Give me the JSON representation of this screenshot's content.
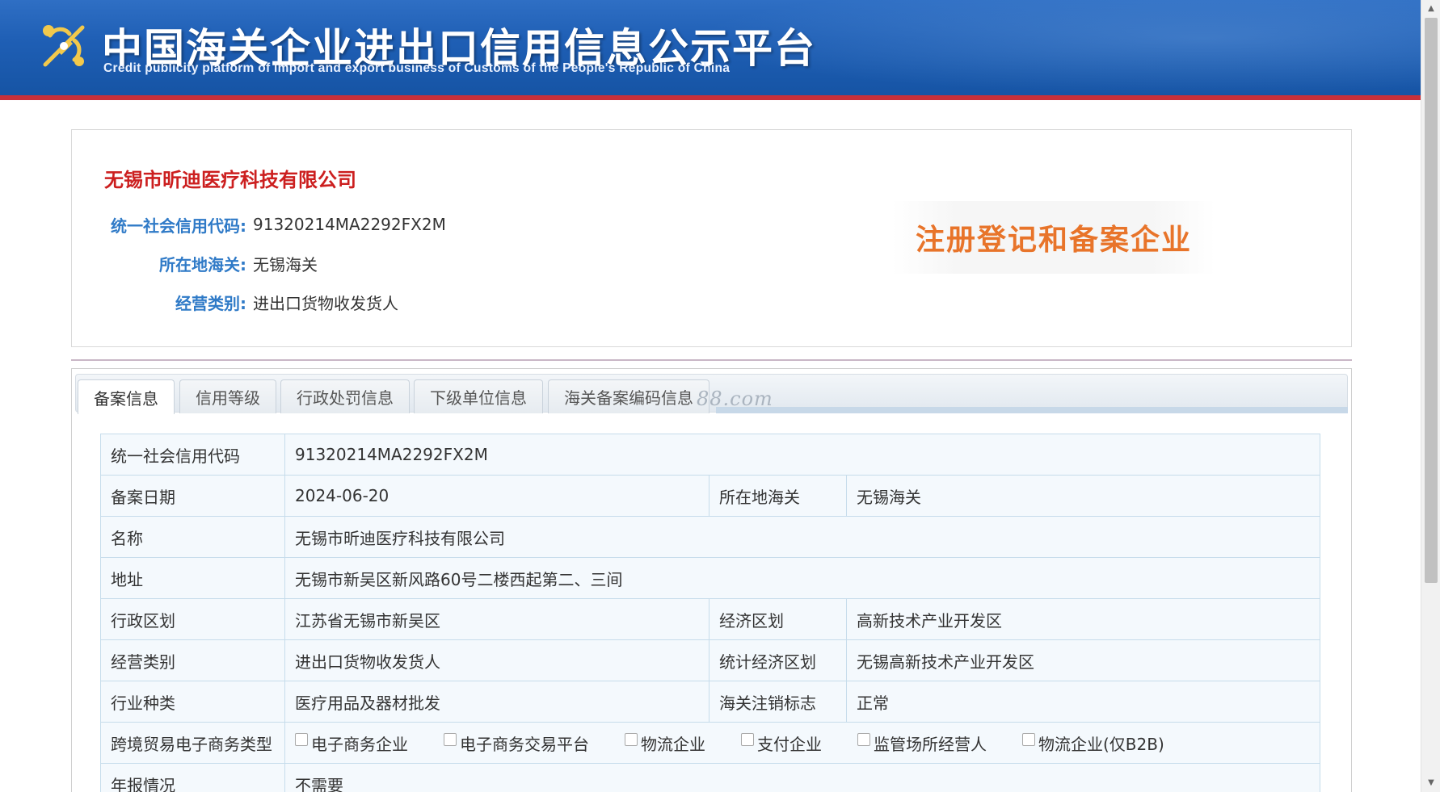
{
  "header": {
    "title": "中国海关企业进出口信用信息公示平台",
    "subtitle": "Credit publicity platform of import and export business of Customs of the People's Republic of China",
    "emblem_icon": "customs-emblem-icon",
    "colors": {
      "banner": "#1f5fb5",
      "accent_line": "#c7303a"
    }
  },
  "summary": {
    "company_name": "无锡市昕迪医疗科技有限公司",
    "rows": [
      {
        "label": "统一社会信用代码:",
        "value": "91320214MA2292FX2M"
      },
      {
        "label": "所在地海关:",
        "value": "无锡海关"
      },
      {
        "label": "经营类别:",
        "value": "进出口货物收发货人"
      }
    ],
    "stamp": "注册登记和备案企业",
    "colors": {
      "company_name": "#cc1f1f",
      "label": "#2f7ac7",
      "stamp": "#e8742a"
    }
  },
  "tabs": [
    {
      "label": "备案信息",
      "active": true
    },
    {
      "label": "信用等级",
      "active": false
    },
    {
      "label": "行政处罚信息",
      "active": false
    },
    {
      "label": "下级单位信息",
      "active": false
    },
    {
      "label": "海关备案编码信息",
      "active": false
    }
  ],
  "watermark": "88.com",
  "record": {
    "credit_code_label": "统一社会信用代码",
    "credit_code": "91320214MA2292FX2M",
    "record_date_label": "备案日期",
    "record_date": "2024-06-20",
    "customs_label": "所在地海关",
    "customs": "无锡海关",
    "name_label": "名称",
    "name": "无锡市昕迪医疗科技有限公司",
    "address_label": "地址",
    "address": "无锡市新吴区新风路60号二楼西起第二、三间",
    "admin_region_label": "行政区划",
    "admin_region": "江苏省无锡市新吴区",
    "econ_region_label": "经济区划",
    "econ_region": "高新技术产业开发区",
    "biz_type_label": "经营类别",
    "biz_type": "进出口货物收发货人",
    "stat_region_label": "统计经济区划",
    "stat_region": "无锡高新技术产业开发区",
    "industry_label": "行业种类",
    "industry": "医疗用品及器材批发",
    "cancel_flag_label": "海关注销标志",
    "cancel_flag": "正常",
    "ecommerce_label": "跨境贸易电子商务类型",
    "ecommerce_options": [
      {
        "label": "电子商务企业",
        "checked": false
      },
      {
        "label": "电子商务交易平台",
        "checked": false
      },
      {
        "label": "物流企业",
        "checked": false
      },
      {
        "label": "支付企业",
        "checked": false
      },
      {
        "label": "监管场所经营人",
        "checked": false
      },
      {
        "label": "物流企业(仅B2B)",
        "checked": false
      }
    ],
    "annual_report_label": "年报情况",
    "annual_report": "不需要"
  }
}
